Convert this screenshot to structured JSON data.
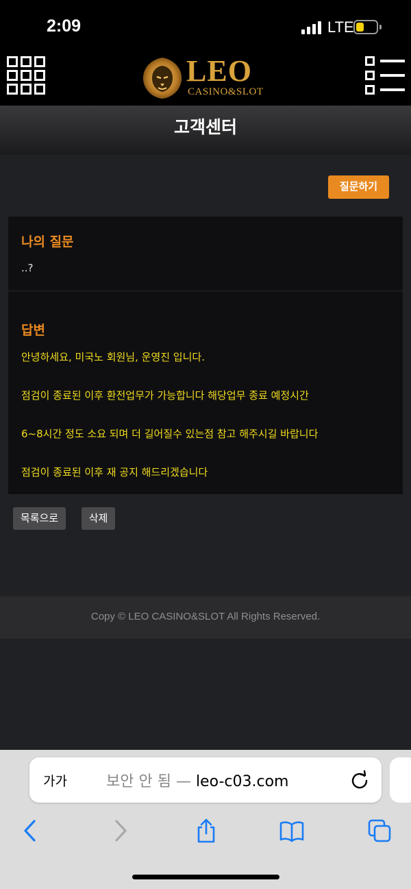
{
  "status": {
    "time": "2:09",
    "network": "LTE",
    "battery_level": 0.4,
    "battery_color": "#f5d20a"
  },
  "header": {
    "logo_word": "LEO",
    "logo_sub": "CASINO&SLOT"
  },
  "page_title": "고객센터",
  "actions": {
    "ask_label": "질문하기",
    "list_label": "목록으로",
    "delete_label": "삭제"
  },
  "question": {
    "title": "나의 질문",
    "text": "..?"
  },
  "answer": {
    "title": "답변",
    "lines": [
      "안녕하세요, 미국노 회원님, 운영진 입니다.",
      "점검이 종료된 이후 환전업무가 가능합니다 해당업무 종료 예정시간",
      "6~8시간 정도 소요 되며 더 길어질수 있는점 참고 해주시길 바랍니다",
      "점검이 종료된 이후 재 공지 해드리겠습니다"
    ]
  },
  "footer": {
    "copyright": "Copy © LEO CASINO&SLOT All Rights Reserved."
  },
  "browser": {
    "text_size_label": "가가",
    "insecure_label": "보안 안 됨 — ",
    "domain": "leo-c03.com"
  },
  "colors": {
    "accent": "#e98a21",
    "answer_text": "#f2dc1e",
    "link_blue": "#1a7cf5"
  }
}
